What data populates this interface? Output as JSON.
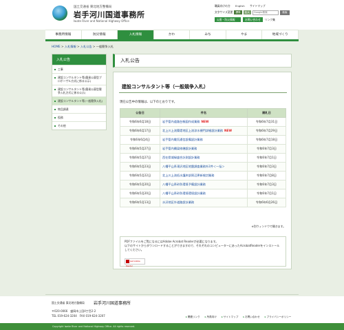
{
  "header": {
    "org_sub": "国土交通省 東北地方整備局",
    "title": "岩手河川国道事務所",
    "title_en": "Iwate River and National Highway Office",
    "util_links": [
      "職員向けの方",
      "English",
      "サイトマップ"
    ],
    "font_size_label": "文字サイズ変更",
    "size_options": [
      "標準",
      "拡大"
    ],
    "search_placeholder": "Google検索",
    "search_button": "検索",
    "disaster_button": "災害・防災情報",
    "contact_button": "お問い合わせ",
    "link_label": "リンク集"
  },
  "nav": {
    "items": [
      "事務所情報",
      "防災情報",
      "入札情報",
      "かわ",
      "みち",
      "やま",
      "地域づくり"
    ],
    "active_index": 2
  },
  "breadcrumb": {
    "items": [
      "HOME",
      "入札情報",
      "入札公告",
      "一般競争入札"
    ],
    "separator": " > "
  },
  "sidebar": {
    "heading": "入札公告",
    "items": [
      "工事",
      "建設コンサルタント等(簡易公募型プロポーザル方式に係る公示)",
      "建設コンサルタント等(簡易公募型競争入札方式に係る公示)",
      "建設コンサルタント等(一般競争入札)",
      "物品調達",
      "役務",
      "その他"
    ],
    "selected_index": 3
  },
  "main": {
    "page_title": "入札公告",
    "section_title": "建設コンサルタント等（一般競争入札）",
    "intro": "現在公告中の情報は、以下のとおりです。",
    "table_headers": [
      "公告日",
      "件名",
      "開札日"
    ],
    "rows": [
      {
        "date": "令和6年6月18日",
        "name": "岩手管内道路台帳図作成業務",
        "new": "NEW",
        "open": "令和6年7月31日"
      },
      {
        "date": "令和6年6月17日",
        "name": "北上川上流築堤地区上流涼水樋門詳細設計業務",
        "new": "NEW",
        "open": "令和6年7月29日"
      },
      {
        "date": "令和6年6月4日",
        "name": "岩手管内電気通信設備設計業務",
        "new": "",
        "open": "令和6年7月18日"
      },
      {
        "date": "令和6年5月27日",
        "name": "岩手管内橋梁修繕設計業務",
        "new": "",
        "open": "令和6年7月3日"
      },
      {
        "date": "令和6年5月27日",
        "name": "西在県域緑盛合計測設計業務",
        "new": "",
        "open": "令和6年7月1日"
      },
      {
        "date": "令和6年5月23日",
        "name": "八幡平山系滝沢地区地盤調査業務外2件＜一括＞",
        "new": "",
        "open": "令和6年7月3日"
      },
      {
        "date": "令和6年5月22日",
        "name": "北上川上流低水護岸部周辺更新検討業務",
        "new": "",
        "open": "令和6年7月8日"
      },
      {
        "date": "令和6年5月20日",
        "name": "八幡平山系砂防環境予備設計業務",
        "new": "",
        "open": "令和6年7月3日"
      },
      {
        "date": "令和6年5月20日",
        "name": "八幡平山系砂防環境環境設計業務",
        "new": "",
        "open": "令和6年7月1日"
      },
      {
        "date": "令和6年5月13日",
        "name": "水沢地区外道路設計業務",
        "new": "",
        "open": "令和6年6月26日"
      }
    ],
    "newwin_note": "※別ウィンドウで開きます。",
    "pdf_line1": "PDFファイルをご覧になるにはAdobe Acrobat Readerが必要になります。",
    "pdf_line2": "以下のサイトからダウンロードすることができますので、それぞれのコンピューターにあったAcrobatReaderをインストールしてください。",
    "pdf_badge": "Get Adobe Reader"
  },
  "footer": {
    "org_sub": "国土交通省 東北地方整備局",
    "org": "岩手河川国道事務所",
    "addr1": "〒020-0066　盛岡市上田4丁目2-2",
    "addr2": "TEL 019-624-3204　FAX 019-624-3207",
    "links": [
      "関連リンク",
      "所員向け",
      "サイトマップ",
      "お問い合わせ",
      "プライバシーポリシー"
    ],
    "copyright": "Copyright Iwate River and National Highway Office. All rights reserved."
  },
  "colors": {
    "accent": "#2f8f3f",
    "page_bg": "#e9efe4",
    "table_header": "#cfe2c4",
    "link": "#1a4e9e",
    "new_badge": "#e02020"
  }
}
